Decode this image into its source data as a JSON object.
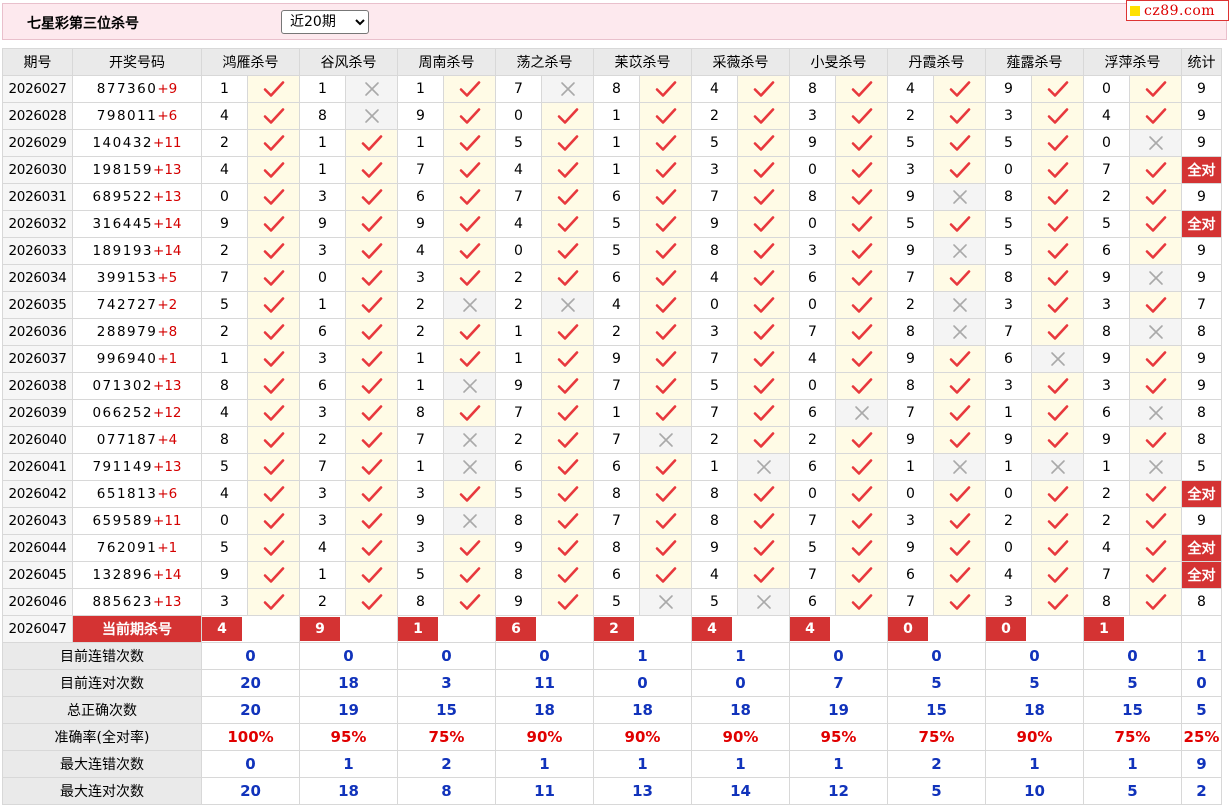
{
  "header": {
    "title": "七星彩第三位杀号",
    "period_selected": "近20期",
    "period_options": [
      "近20期"
    ],
    "logo_text": "cz89.com"
  },
  "columns": {
    "issue": "期号",
    "draw": "开奖号码",
    "experts": [
      "鸿雁杀号",
      "谷风杀号",
      "周南杀号",
      "荡之杀号",
      "苿苡杀号",
      "采薇杀号",
      "小旻杀号",
      "丹霞杀号",
      "薤露杀号",
      "浮萍杀号"
    ],
    "stats": "统计"
  },
  "rows": [
    {
      "issue": "2026027",
      "digits": "877360",
      "plus": "+9",
      "k": [
        1,
        1,
        1,
        7,
        8,
        4,
        8,
        4,
        9,
        0
      ],
      "h": [
        1,
        0,
        1,
        0,
        1,
        1,
        1,
        1,
        1,
        1
      ],
      "stat": "9"
    },
    {
      "issue": "2026028",
      "digits": "798011",
      "plus": "+6",
      "k": [
        4,
        8,
        9,
        0,
        1,
        2,
        3,
        2,
        3,
        4
      ],
      "h": [
        1,
        0,
        1,
        1,
        1,
        1,
        1,
        1,
        1,
        1
      ],
      "stat": "9"
    },
    {
      "issue": "2026029",
      "digits": "140432",
      "plus": "+11",
      "k": [
        2,
        1,
        1,
        5,
        1,
        5,
        9,
        5,
        5,
        0
      ],
      "h": [
        1,
        1,
        1,
        1,
        1,
        1,
        1,
        1,
        1,
        0
      ],
      "stat": "9"
    },
    {
      "issue": "2026030",
      "digits": "198159",
      "plus": "+13",
      "k": [
        4,
        1,
        7,
        4,
        1,
        3,
        0,
        3,
        0,
        7
      ],
      "h": [
        1,
        1,
        1,
        1,
        1,
        1,
        1,
        1,
        1,
        1
      ],
      "stat": "全对"
    },
    {
      "issue": "2026031",
      "digits": "689522",
      "plus": "+13",
      "k": [
        0,
        3,
        6,
        7,
        6,
        7,
        8,
        9,
        8,
        2
      ],
      "h": [
        1,
        1,
        1,
        1,
        1,
        1,
        1,
        0,
        1,
        1
      ],
      "stat": "9"
    },
    {
      "issue": "2026032",
      "digits": "316445",
      "plus": "+14",
      "k": [
        9,
        9,
        9,
        4,
        5,
        9,
        0,
        5,
        5,
        5
      ],
      "h": [
        1,
        1,
        1,
        1,
        1,
        1,
        1,
        1,
        1,
        1
      ],
      "stat": "全对"
    },
    {
      "issue": "2026033",
      "digits": "189193",
      "plus": "+14",
      "k": [
        2,
        3,
        4,
        0,
        5,
        8,
        3,
        9,
        5,
        6
      ],
      "h": [
        1,
        1,
        1,
        1,
        1,
        1,
        1,
        0,
        1,
        1
      ],
      "stat": "9"
    },
    {
      "issue": "2026034",
      "digits": "399153",
      "plus": "+5",
      "k": [
        7,
        0,
        3,
        2,
        6,
        4,
        6,
        7,
        8,
        9
      ],
      "h": [
        1,
        1,
        1,
        1,
        1,
        1,
        1,
        1,
        1,
        0
      ],
      "stat": "9"
    },
    {
      "issue": "2026035",
      "digits": "742727",
      "plus": "+2",
      "k": [
        5,
        1,
        2,
        2,
        4,
        0,
        0,
        2,
        3,
        3
      ],
      "h": [
        1,
        1,
        0,
        0,
        1,
        1,
        1,
        0,
        1,
        1
      ],
      "stat": "7"
    },
    {
      "issue": "2026036",
      "digits": "288979",
      "plus": "+8",
      "k": [
        2,
        6,
        2,
        1,
        2,
        3,
        7,
        8,
        7,
        8
      ],
      "h": [
        1,
        1,
        1,
        1,
        1,
        1,
        1,
        0,
        1,
        0
      ],
      "stat": "8"
    },
    {
      "issue": "2026037",
      "digits": "996940",
      "plus": "+1",
      "k": [
        1,
        3,
        1,
        1,
        9,
        7,
        4,
        9,
        6,
        9
      ],
      "h": [
        1,
        1,
        1,
        1,
        1,
        1,
        1,
        1,
        0,
        1
      ],
      "stat": "9"
    },
    {
      "issue": "2026038",
      "digits": "071302",
      "plus": "+13",
      "k": [
        8,
        6,
        1,
        9,
        7,
        5,
        0,
        8,
        3,
        3
      ],
      "h": [
        1,
        1,
        0,
        1,
        1,
        1,
        1,
        1,
        1,
        1
      ],
      "stat": "9"
    },
    {
      "issue": "2026039",
      "digits": "066252",
      "plus": "+12",
      "k": [
        4,
        3,
        8,
        7,
        1,
        7,
        6,
        7,
        1,
        6
      ],
      "h": [
        1,
        1,
        1,
        1,
        1,
        1,
        0,
        1,
        1,
        0
      ],
      "stat": "8"
    },
    {
      "issue": "2026040",
      "digits": "077187",
      "plus": "+4",
      "k": [
        8,
        2,
        7,
        2,
        7,
        2,
        2,
        9,
        9,
        9
      ],
      "h": [
        1,
        1,
        0,
        1,
        0,
        1,
        1,
        1,
        1,
        1
      ],
      "stat": "8"
    },
    {
      "issue": "2026041",
      "digits": "791149",
      "plus": "+13",
      "k": [
        5,
        7,
        1,
        6,
        6,
        1,
        6,
        1,
        1,
        1
      ],
      "h": [
        1,
        1,
        0,
        1,
        1,
        0,
        1,
        0,
        0,
        0
      ],
      "stat": "5"
    },
    {
      "issue": "2026042",
      "digits": "651813",
      "plus": "+6",
      "k": [
        4,
        3,
        3,
        5,
        8,
        8,
        0,
        0,
        0,
        2
      ],
      "h": [
        1,
        1,
        1,
        1,
        1,
        1,
        1,
        1,
        1,
        1
      ],
      "stat": "全对"
    },
    {
      "issue": "2026043",
      "digits": "659589",
      "plus": "+11",
      "k": [
        0,
        3,
        9,
        8,
        7,
        8,
        7,
        3,
        2,
        2
      ],
      "h": [
        1,
        1,
        0,
        1,
        1,
        1,
        1,
        1,
        1,
        1
      ],
      "stat": "9"
    },
    {
      "issue": "2026044",
      "digits": "762091",
      "plus": "+1",
      "k": [
        5,
        4,
        3,
        9,
        8,
        9,
        5,
        9,
        0,
        4
      ],
      "h": [
        1,
        1,
        1,
        1,
        1,
        1,
        1,
        1,
        1,
        1
      ],
      "stat": "全对"
    },
    {
      "issue": "2026045",
      "digits": "132896",
      "plus": "+14",
      "k": [
        9,
        1,
        5,
        8,
        6,
        4,
        7,
        6,
        4,
        7
      ],
      "h": [
        1,
        1,
        1,
        1,
        1,
        1,
        1,
        1,
        1,
        1
      ],
      "stat": "全对"
    },
    {
      "issue": "2026046",
      "digits": "885623",
      "plus": "+13",
      "k": [
        3,
        2,
        8,
        9,
        5,
        5,
        6,
        7,
        3,
        8
      ],
      "h": [
        1,
        1,
        1,
        1,
        0,
        0,
        1,
        1,
        1,
        1
      ],
      "stat": "8"
    }
  ],
  "current": {
    "issue": "2026047",
    "label": "当前期杀号",
    "kills": [
      "4",
      "9",
      "1",
      "6",
      "2",
      "4",
      "4",
      "0",
      "0",
      "1"
    ]
  },
  "summary": [
    {
      "label": "目前连错次数",
      "values": [
        "0",
        "0",
        "0",
        "0",
        "1",
        "1",
        "0",
        "0",
        "0",
        "0",
        "1"
      ],
      "red": false
    },
    {
      "label": "目前连对次数",
      "values": [
        "20",
        "18",
        "3",
        "11",
        "0",
        "0",
        "7",
        "5",
        "5",
        "5",
        "0"
      ],
      "red": false
    },
    {
      "label": "总正确次数",
      "values": [
        "20",
        "19",
        "15",
        "18",
        "18",
        "18",
        "19",
        "15",
        "18",
        "15",
        "5"
      ],
      "red": false
    },
    {
      "label": "准确率(全对率)",
      "values": [
        "100%",
        "95%",
        "75%",
        "90%",
        "90%",
        "90%",
        "95%",
        "75%",
        "90%",
        "75%",
        "25%"
      ],
      "red": true
    },
    {
      "label": "最大连错次数",
      "values": [
        "0",
        "1",
        "2",
        "1",
        "1",
        "1",
        "1",
        "2",
        "1",
        "1",
        "9"
      ],
      "red": false
    },
    {
      "label": "最大连对次数",
      "values": [
        "20",
        "18",
        "8",
        "11",
        "13",
        "14",
        "12",
        "5",
        "10",
        "5",
        "2"
      ],
      "red": false
    }
  ],
  "colors": {
    "accent_red": "#d43333",
    "hit_check": "#e8383d",
    "miss_cross": "#a9a9a9",
    "summary_blue": "#1133bb",
    "header_bg": "#fde9ee"
  },
  "icons": {
    "hit": "checkmark-icon",
    "miss": "cross-icon"
  }
}
